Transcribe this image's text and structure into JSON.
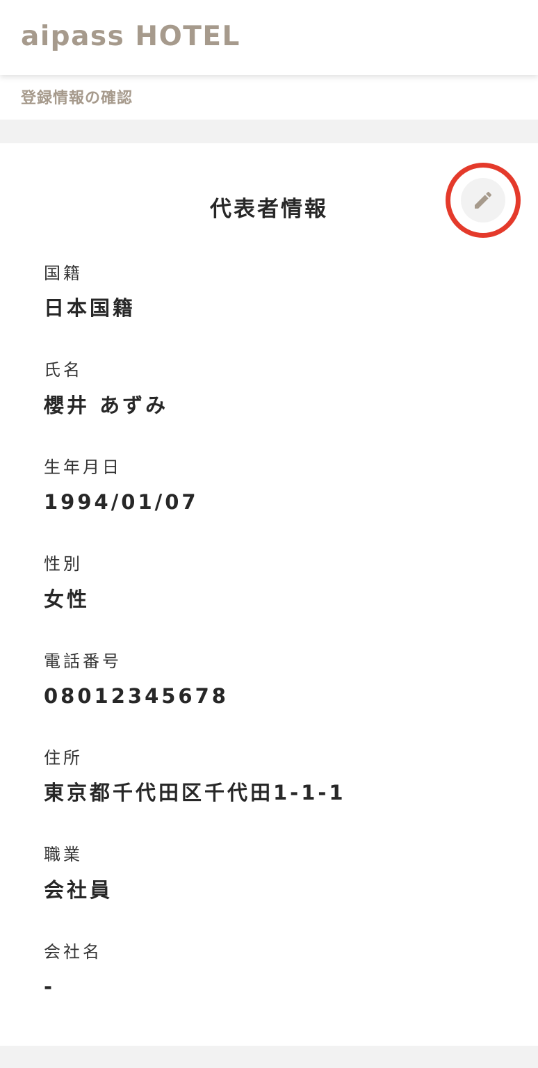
{
  "header": {
    "brand": "aipass HOTEL"
  },
  "page_title": "登録情報の確認",
  "section": {
    "title": "代表者情報",
    "edit_icon": "pencil-icon",
    "highlight_color": "#e43a2b"
  },
  "fields": [
    {
      "label": "国籍",
      "value": "日本国籍"
    },
    {
      "label": "氏名",
      "value": "櫻井 あずみ"
    },
    {
      "label": "生年月日",
      "value": "1994/01/07"
    },
    {
      "label": "性別",
      "value": "女性"
    },
    {
      "label": "電話番号",
      "value": "08012345678"
    },
    {
      "label": "住所",
      "value": "東京都千代田区千代田1-1-1"
    },
    {
      "label": "職業",
      "value": "会社員"
    },
    {
      "label": "会社名",
      "value": "-"
    }
  ],
  "colors": {
    "brand": "#a69a8c",
    "text": "#272727",
    "background": "#f2f2f2"
  }
}
